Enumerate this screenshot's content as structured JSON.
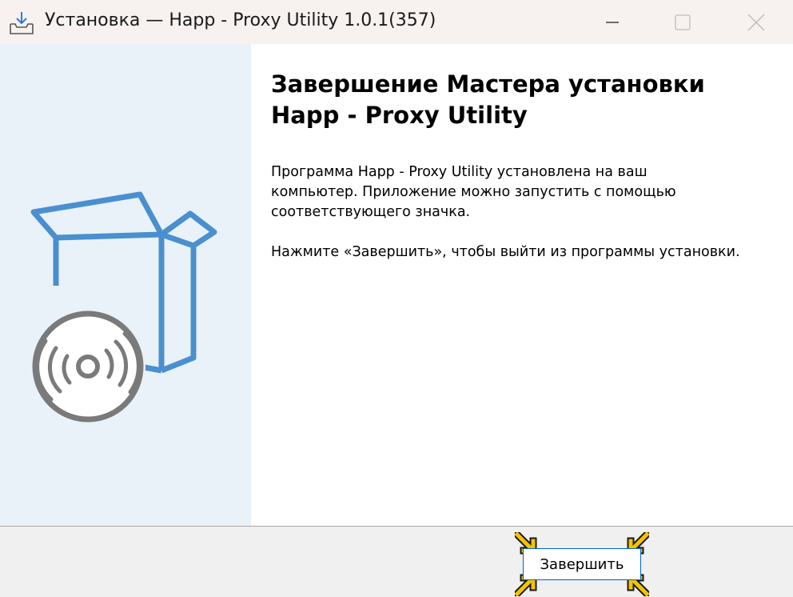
{
  "window": {
    "title": "Установка — Happ - Proxy Utility 1.0.1(357)"
  },
  "titlebar_icons": [
    "installer-icon",
    "minimize-icon",
    "maximize-icon",
    "close-icon"
  ],
  "content": {
    "heading_line1": "Завершение Мастера установки",
    "heading_line2": "Happ - Proxy Utility",
    "paragraph1": "Программа Happ - Proxy Utility установлена на ваш компьютер. Приложение можно запустить с помощью соответствующего значка.",
    "paragraph2": "Нажмите «Завершить», чтобы выйти из программы установки."
  },
  "footer": {
    "finish_label": "Завершить"
  },
  "colors": {
    "side_panel": "#e9f2f9",
    "box_stroke": "#4a8fcf",
    "disc_gray": "#7a7a7a",
    "focus_arrows": "#f5c400",
    "button_border": "#0067c0"
  }
}
